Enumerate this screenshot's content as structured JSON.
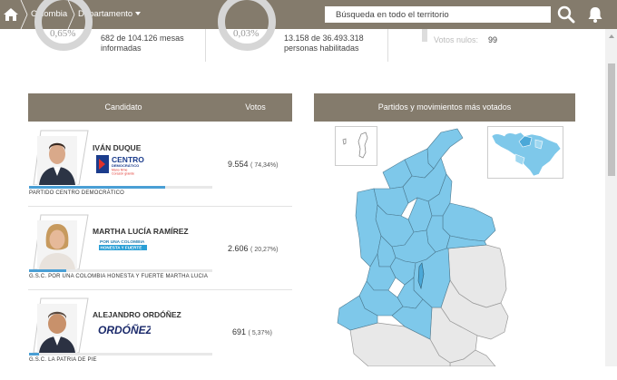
{
  "nav": {
    "breadcrumb_country": "Colombia",
    "breadcrumb_dept": "Departamento",
    "search_placeholder": "Búsqueda en todo el territorio",
    "icons": [
      "home-icon",
      "search-icon",
      "bell-icon"
    ]
  },
  "stats": {
    "tables_pct": "0,65%",
    "tables_line1": "682 de 104.126 mesas",
    "tables_line2": "informadas",
    "voters_pct": "0,03%",
    "voters_line1": "13.158 de 36.493.318",
    "voters_line2": "personas habilitadas",
    "null_label": "Votos nulos:",
    "null_value": "99"
  },
  "table": {
    "col_candidate": "Candidato",
    "col_votes": "Votos",
    "rows": [
      {
        "name": "IVÁN DUQUE",
        "votes": "9.554",
        "pct": "( 74,34%)",
        "share": 0.7434,
        "party": "PARTIDO CENTRO DEMOCRÁTICO",
        "logo_line1": "CENTRO",
        "logo_line2": "DEMOCRÁTICO",
        "logo_line3": "Mano firme",
        "logo_line4": "Corazón grande"
      },
      {
        "name": "MARTHA LUCÍA RAMÍREZ",
        "votes": "2.606",
        "pct": "( 20,27%)",
        "share": 0.2027,
        "party": "G.S.C. POR UNA COLOMBIA HONESTA Y FUERTE MARTHA LUCIA",
        "logo_line1": "POR UNA COLOMBIA",
        "logo_line2": "HONESTA Y FUERTE"
      },
      {
        "name": "ALEJANDRO ORDÓÑEZ",
        "votes": "691",
        "pct": "( 5,37%)",
        "share": 0.0537,
        "party": "G.S.C. LA PATRIA DE PIE",
        "logo_line1": "ORDÓÑEZ"
      }
    ]
  },
  "map": {
    "title": "Partidos y movimientos más votados",
    "fill_color": "#7ec8ea",
    "empty_color": "#e8e8e8"
  },
  "colors": {
    "header_bg": "#847b6c",
    "bar_blue": "#4a9fd5"
  }
}
